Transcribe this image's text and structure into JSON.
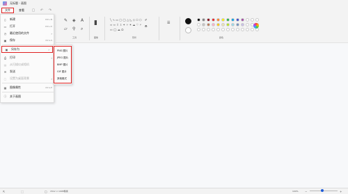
{
  "window": {
    "title": "无标题 - 画图"
  },
  "menubar": {
    "file": "文件",
    "view": "查看",
    "undo_icon": "undo-icon",
    "redo_icon": "redo-icon",
    "save_icon": "save-icon"
  },
  "ribbon": {
    "groups": {
      "tools": "工具",
      "image": "图像",
      "shapes": "形状",
      "colors": "颜色"
    }
  },
  "file_menu": {
    "items": [
      {
        "label": "新建",
        "shortcut": "Ctrl+N",
        "icon": "new-file-icon",
        "enabled": true
      },
      {
        "label": "打开",
        "shortcut": "Ctrl+O",
        "icon": "open-folder-icon",
        "enabled": true
      },
      {
        "label": "最近使用的文件",
        "icon": "recent-files-icon",
        "enabled": true,
        "submenu": true
      },
      {
        "label": "保存",
        "shortcut": "Ctrl+S",
        "icon": "save-icon",
        "enabled": true
      },
      {
        "label": "另存为",
        "icon": "save-as-icon",
        "enabled": true,
        "submenu": true,
        "highlighted": true
      },
      {
        "label": "打印",
        "icon": "print-icon",
        "enabled": true,
        "submenu": true
      },
      {
        "label": "从扫描仪或相机",
        "icon": "scanner-icon",
        "enabled": false
      },
      {
        "label": "发送",
        "icon": "send-icon",
        "enabled": true
      },
      {
        "label": "设置为桌面背景",
        "icon": "desktop-background-icon",
        "enabled": false,
        "submenu": true
      },
      {
        "label": "图像属性",
        "shortcut": "Ctrl+E",
        "icon": "image-properties-icon",
        "enabled": true
      },
      {
        "label": "关于画图",
        "icon": "info-icon",
        "enabled": true
      }
    ]
  },
  "save_as_submenu": {
    "items": [
      "PNG 图片",
      "JPEG 图片",
      "BMP 图片",
      "GIF 图片",
      "其他格式"
    ]
  },
  "colors": {
    "primary": "#111111",
    "secondary": "#ffffff",
    "palette_row1": [
      "#000000",
      "#7f7f7f",
      "#880015",
      "#ed1c24",
      "#ff7f27",
      "#fff200",
      "#22b14c",
      "#00a2e8",
      "#3f48cc",
      "#a349a4",
      "#ffffff",
      "#ffffff",
      "#ffffff"
    ],
    "palette_row2": [
      "#ffffff",
      "#c3c3c3",
      "#b97a57",
      "#ffaec9",
      "#ffc90e",
      "#efe4b0",
      "#b5e61d",
      "#99d9ea",
      "#7092be",
      "#c8bfe7",
      "#ffffff",
      "#ffffff",
      "#ffffff"
    ],
    "palette_row3": [
      "#ffffff",
      "#ffffff",
      "#ffffff",
      "#ffffff",
      "#ffffff",
      "#ffffff",
      "#ffffff",
      "#ffffff",
      "#ffffff",
      "#ffffff",
      "#ffffff",
      "#ffffff",
      "#ffffff"
    ]
  },
  "statusbar": {
    "canvas_size": "1512 × 1008像素",
    "zoom": "100%"
  }
}
